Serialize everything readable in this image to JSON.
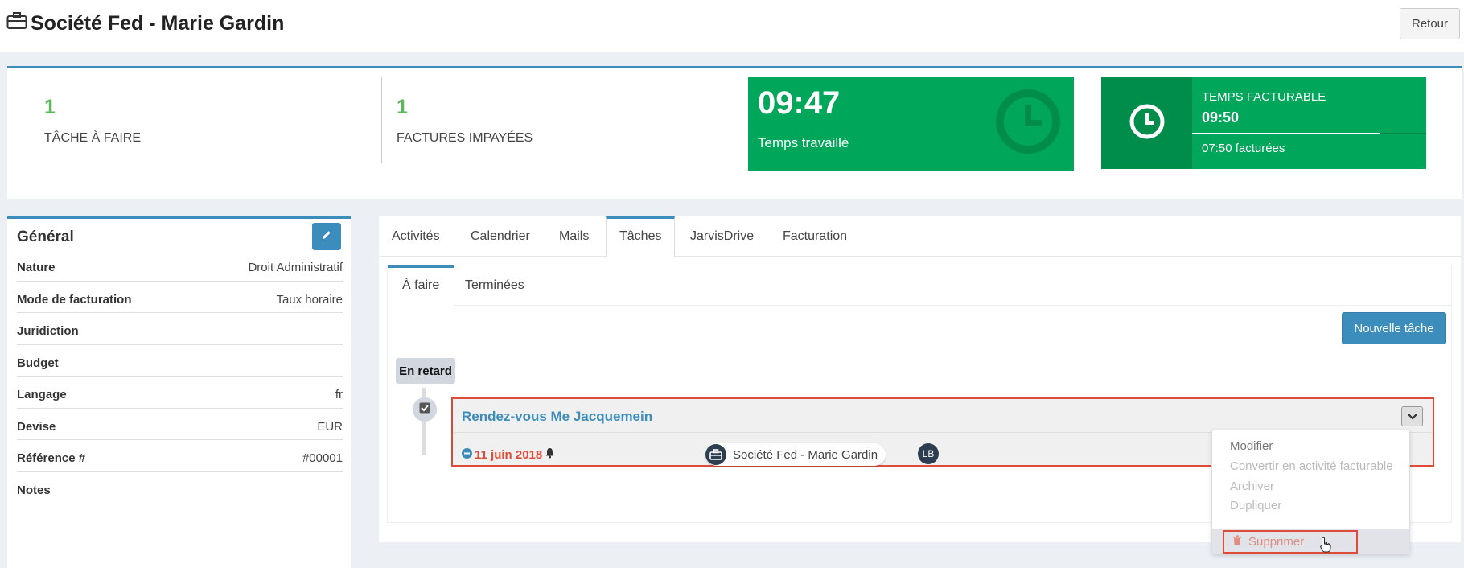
{
  "header": {
    "title": "Société Fed - Marie Gardin",
    "back_label": "Retour"
  },
  "stats": {
    "tasks_count": "1",
    "tasks_label": "TÂCHE À FAIRE",
    "invoices_count": "1",
    "invoices_label": "FACTURES IMPAYÉES",
    "worked_time": "09:47",
    "worked_label": "Temps travaillé",
    "billable_title": "TEMPS FACTURABLE",
    "billable_time": "09:50",
    "billed_text": "07:50 facturées",
    "billed_fraction": 0.8
  },
  "general": {
    "title": "Général",
    "rows": [
      {
        "key": "Nature",
        "value": "Droit Administratif"
      },
      {
        "key": "Mode de facturation",
        "value": "Taux horaire"
      },
      {
        "key": "Juridiction",
        "value": ""
      },
      {
        "key": "Budget",
        "value": ""
      },
      {
        "key": "Langage",
        "value": "fr"
      },
      {
        "key": "Devise",
        "value": "EUR"
      },
      {
        "key": "Référence #",
        "value": "#00001"
      },
      {
        "key": "Notes",
        "value": ""
      }
    ]
  },
  "tabs": [
    "Activités",
    "Calendrier",
    "Mails",
    "Tâches",
    "JarvisDrive",
    "Facturation"
  ],
  "active_tab": "Tâches",
  "subtabs": [
    "À faire",
    "Terminées"
  ],
  "new_task_label": "Nouvelle tâche",
  "late_label": "En retard",
  "task": {
    "title": "Rendez-vous Me Jacquemein",
    "date": "11 juin 2018",
    "client": "Société Fed - Marie Gardin",
    "assignee_initials": "LB"
  },
  "menu": {
    "items": [
      "Modifier",
      "Convertir en activité facturable",
      "Archiver",
      "Dupliquer"
    ],
    "delete_label": "Supprimer"
  },
  "colors": {
    "primary": "#3c8dbc",
    "success": "#00a65a",
    "success_dark": "#008d4c",
    "danger": "#dd4b39"
  }
}
